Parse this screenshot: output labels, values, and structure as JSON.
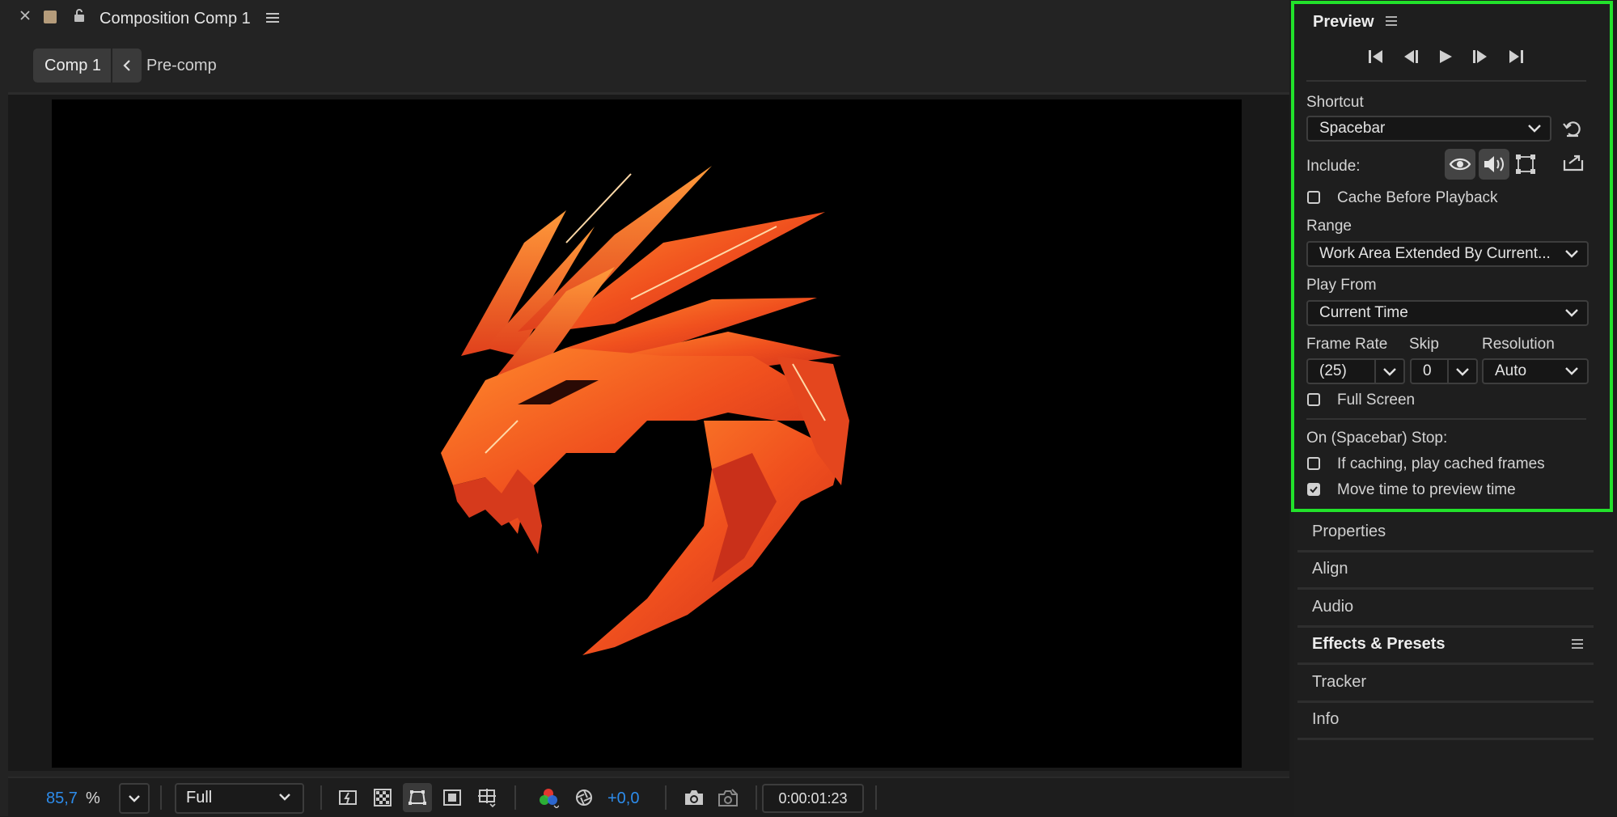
{
  "composition": {
    "title": "Composition Comp 1",
    "breadcrumbs": [
      "Comp 1",
      "Pre-comp"
    ]
  },
  "viewer_toolbar": {
    "zoom_value": "85,7",
    "zoom_unit": "%",
    "resolution": "Full",
    "exposure": "+0,0",
    "timecode": "0:00:01:23"
  },
  "preview": {
    "title": "Preview",
    "shortcut_label": "Shortcut",
    "shortcut_value": "Spacebar",
    "include_label": "Include:",
    "cache_before_playback": "Cache Before Playback",
    "cache_before_playback_checked": false,
    "range_label": "Range",
    "range_value": "Work Area Extended By Current...",
    "play_from_label": "Play From",
    "play_from_value": "Current Time",
    "frame_rate_label": "Frame Rate",
    "frame_rate_value": "(25)",
    "skip_label": "Skip",
    "skip_value": "0",
    "resolution_label": "Resolution",
    "resolution_value": "Auto",
    "full_screen": "Full Screen",
    "full_screen_checked": false,
    "on_stop_label": "On (Spacebar) Stop:",
    "if_caching": "If caching, play cached frames",
    "if_caching_checked": false,
    "move_time": "Move time to preview time",
    "move_time_checked": true
  },
  "panels": [
    {
      "label": "Properties"
    },
    {
      "label": "Align"
    },
    {
      "label": "Audio"
    },
    {
      "label": "Effects & Presets"
    },
    {
      "label": "Tracker"
    },
    {
      "label": "Info"
    }
  ],
  "colors": {
    "highlight_border": "#22e22b",
    "accent_blue": "#2d8ceb",
    "dragon_orange": "#f04a1e"
  }
}
